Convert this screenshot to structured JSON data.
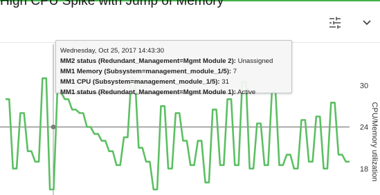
{
  "header": {
    "title": "High CPU Spike with Jump of Memory"
  },
  "icons": {
    "tune": "tune-icon",
    "chevron": "chevron-down-icon"
  },
  "colors": {
    "accent": "#43b14a",
    "series": "#5cbf63",
    "crosshair": "#808080"
  },
  "tooltip": {
    "timestamp": "Wednesday, Oct 25, 2017 14:43:30",
    "rows": [
      {
        "label": "MM2 status (Redundant_Management=Mgmt Module 2):",
        "value": "Unassigned"
      },
      {
        "label": "MM1 Memory (Subsystem=management_module_1/5):",
        "value": "7"
      },
      {
        "label": "MM1 CPU (Subsystem=management_module_1/5):",
        "value": "31"
      },
      {
        "label": "MM1 status (Redundant_Management=Mgmt Module 1):",
        "value": "Active"
      }
    ]
  },
  "chart_data": {
    "type": "line",
    "ylabel": "CPU/Memory utilization",
    "yticks": [
      18,
      24,
      30
    ],
    "ylim": [
      14.2,
      36.2
    ],
    "grid": false,
    "crosshair_y": 24,
    "series": [
      {
        "name": "MM1 CPU (Subsystem=management_module_1/5)",
        "values": [
          28.0,
          28.0,
          18.0,
          18.0,
          26.0,
          26.0,
          20.5,
          20.5,
          19.0,
          19.0,
          31.0,
          31.0,
          15.0,
          15.0,
          29.0,
          29.0,
          28.0,
          28.0,
          26.5,
          26.5,
          26.0,
          26.0,
          24.0,
          24.0,
          23.0,
          23.0,
          22.0,
          22.0,
          20.5,
          20.5,
          18.5,
          18.5,
          22.5,
          22.5,
          31.0,
          31.0,
          21.0,
          21.0,
          19.0,
          19.0,
          15.0,
          15.0,
          27.0,
          27.0,
          18.0,
          18.0,
          26.0,
          26.0,
          22.0,
          22.0,
          18.5,
          18.5,
          22.0,
          22.0,
          16.0,
          16.0,
          26.5,
          26.5,
          18.5,
          18.5,
          28.0,
          28.0,
          18.5,
          18.5,
          30.5,
          30.5,
          18.0,
          18.0,
          24.5,
          24.5,
          18.5,
          18.5,
          29.0,
          29.0,
          18.5,
          18.5,
          20.0,
          20.0,
          18.0,
          18.0,
          25.0,
          25.0,
          19.0,
          19.0,
          25.5,
          25.5,
          18.0,
          18.0,
          27.5,
          27.5,
          20.0,
          20.0,
          19.0,
          19.0
        ]
      }
    ]
  }
}
